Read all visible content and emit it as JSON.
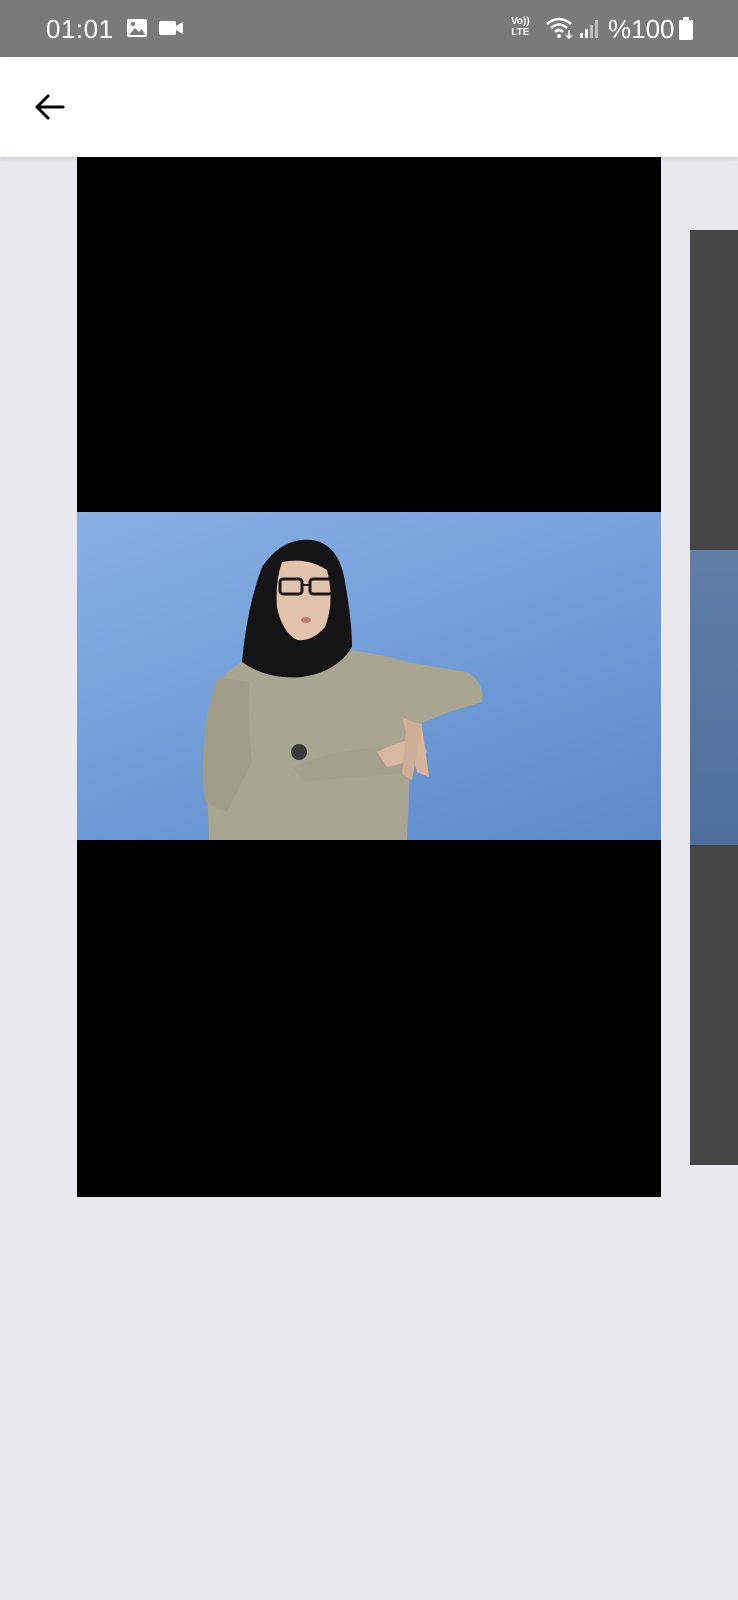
{
  "status_bar": {
    "time": "01:01",
    "volte_top": "Vo))",
    "volte_bottom": "LTE",
    "battery": "%100",
    "icons": [
      "gallery-icon",
      "video-camera-icon",
      "volte-icon",
      "wifi-icon",
      "signal-icon",
      "battery-icon"
    ],
    "background": "#7a7a7a"
  },
  "app_bar": {
    "back_icon": "arrow-left-icon",
    "background": "#ffffff"
  },
  "video_player": {
    "content": "sign-language-video",
    "letterbox_color": "#000000",
    "backdrop_color": "#6f9bd7"
  },
  "next_video": {
    "content": "next-video-preview"
  },
  "colors": {
    "page_background": "#e9e8ef"
  }
}
